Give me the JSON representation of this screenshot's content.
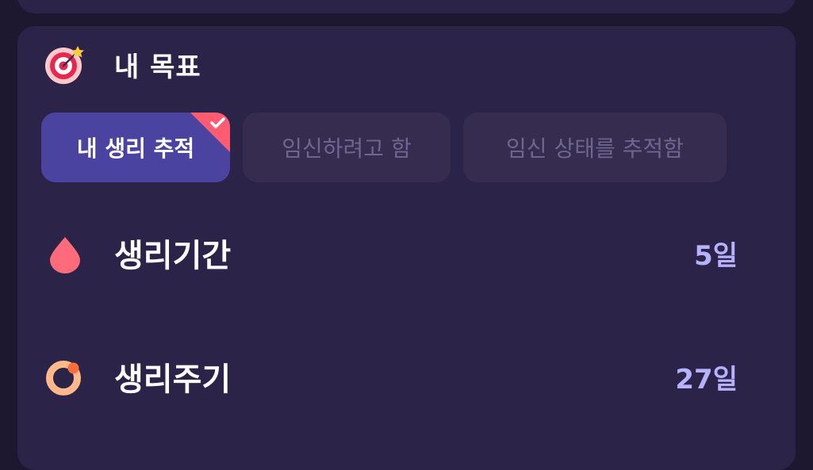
{
  "goal": {
    "title": "내 목표",
    "icon": "target-icon",
    "options": [
      {
        "label": "내 생리 추적",
        "selected": true
      },
      {
        "label": "임신하려고 함",
        "selected": false
      },
      {
        "label": "임신 상태를 추적함",
        "selected": false
      }
    ]
  },
  "settings": [
    {
      "label": "생리기간",
      "value": "5일",
      "icon": "drop-icon"
    },
    {
      "label": "생리주기",
      "value": "27일",
      "icon": "cycle-ring-icon"
    }
  ],
  "colors": {
    "background": "#1d1830",
    "card": "#2c2348",
    "selected_chip": "#4a44a0",
    "unselected_chip": "#352c50",
    "value_text": "#b7b2ff",
    "accent_red": "#ff6b7a",
    "accent_orange": "#ffb98a"
  }
}
